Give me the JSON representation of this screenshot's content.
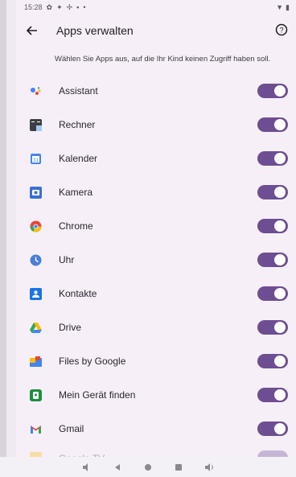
{
  "status_bar": {
    "time": "15:28"
  },
  "app_bar": {
    "title": "Apps verwalten"
  },
  "subtitle": "Wählen Sie Apps aus, auf die Ihr Kind keinen Zugriff haben soll.",
  "apps": [
    {
      "label": "Assistant",
      "icon": "assistant-icon",
      "enabled": true
    },
    {
      "label": "Rechner",
      "icon": "calculator-icon",
      "enabled": true
    },
    {
      "label": "Kalender",
      "icon": "calendar-icon",
      "enabled": true
    },
    {
      "label": "Kamera",
      "icon": "camera-icon",
      "enabled": true
    },
    {
      "label": "Chrome",
      "icon": "chrome-icon",
      "enabled": true
    },
    {
      "label": "Uhr",
      "icon": "clock-icon",
      "enabled": true
    },
    {
      "label": "Kontakte",
      "icon": "contacts-icon",
      "enabled": true
    },
    {
      "label": "Drive",
      "icon": "drive-icon",
      "enabled": true
    },
    {
      "label": "Files by Google",
      "icon": "files-icon",
      "enabled": true
    },
    {
      "label": "Mein Gerät finden",
      "icon": "find-device-icon",
      "enabled": true
    },
    {
      "label": "Gmail",
      "icon": "gmail-icon",
      "enabled": true
    },
    {
      "label": "Google TV",
      "icon": "google-tv-icon",
      "enabled": true
    }
  ],
  "colors": {
    "switch_on": "#6e4e92",
    "background": "#f6eff8"
  }
}
